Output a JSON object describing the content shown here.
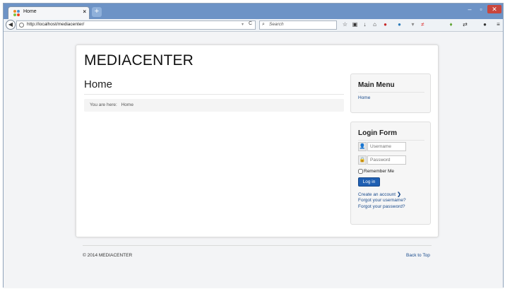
{
  "browser": {
    "tab_title": "Home",
    "tab_close": "×",
    "new_tab": "+",
    "url": "http://localhost/mediacenter/",
    "search_placeholder": "Search",
    "window_buttons": {
      "minimize": "–",
      "maximize": "▫",
      "close": "✕"
    }
  },
  "site": {
    "title": "MEDIACENTER",
    "page_heading": "Home",
    "breadcrumb_prefix": "You are here:",
    "breadcrumb_current": "Home"
  },
  "main_menu": {
    "title": "Main Menu",
    "items": [
      "Home"
    ]
  },
  "login_form": {
    "title": "Login Form",
    "username_placeholder": "Username",
    "password_placeholder": "Password",
    "remember_label": "Remember Me",
    "login_button": "Log in",
    "create_account": "Create an account",
    "forgot_username": "Forgot your username?",
    "forgot_password": "Forgot your password?"
  },
  "footer": {
    "copyright": "© 2014 MEDIACENTER",
    "back_to_top": "Back to Top"
  },
  "colors": {
    "titlebar": "#6d93c6",
    "link": "#1a4b8c",
    "login_button": "#1f5fb2"
  }
}
